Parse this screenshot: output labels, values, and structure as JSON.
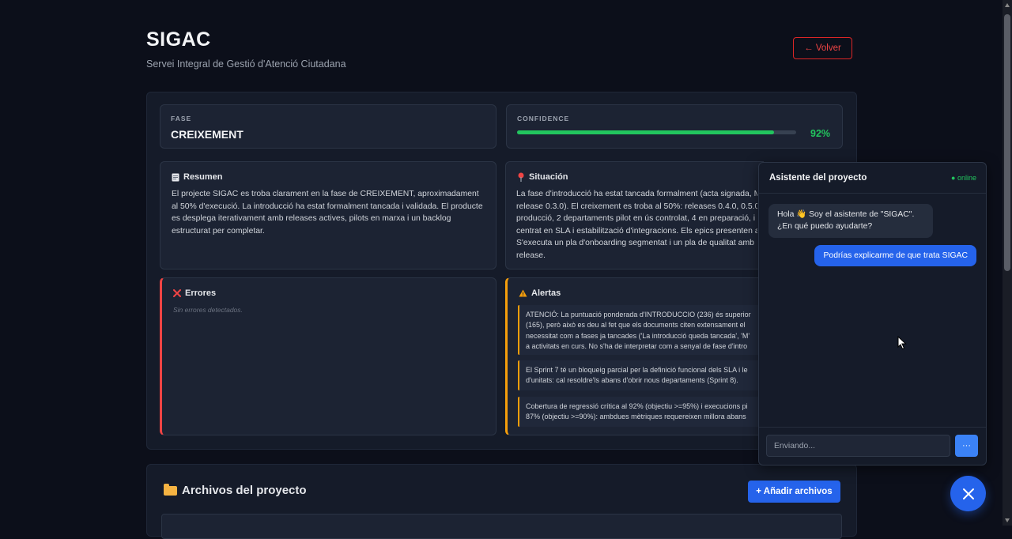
{
  "header": {
    "title": "SIGAC",
    "subtitle": "Servei Integral de Gestió d'Atenció Ciutadana",
    "back_label": "← Volver"
  },
  "phase": {
    "label": "FASE",
    "value": "CREIXEMENT"
  },
  "confidence": {
    "label": "CONFIDENCE",
    "percent_text": "92%",
    "level": 0.92,
    "color": "#22c55e"
  },
  "summary": {
    "icon": "document-icon",
    "title": "Resumen",
    "text": "El projecte SIGAC es troba clarament en la fase de CREIXEMENT, aproximadament al 50% d'execució. La introducció ha estat formalment tancada i validada. El producte es desplega iterativament amb releases actives, pilots en marxa i un backlog estructurat per completar."
  },
  "situation": {
    "icon": "pin-icon",
    "title": "Situación",
    "lines": [
      "La fase d'introducció ha estat tancada formalment (acta signada, M",
      "release 0.3.0). El creixement es troba al 50%: releases 0.4.0, 0.5.0 i 0.",
      "producció, 2 departaments pilot en ús controlat, 4 en preparació, i",
      "centrat en SLA i estabilització d'integracions. Els epics presenten av",
      "S'executa un pla d'onboarding segmentat i un pla de qualitat amb",
      "release."
    ]
  },
  "errors": {
    "icon": "x-icon",
    "title": "Errores",
    "empty_text": "Sin errores detectados."
  },
  "alerts": {
    "icon": "warning-icon",
    "title": "Alertas",
    "items": [
      {
        "lines": [
          "ATENCIÓ: La puntuació ponderada d'INTRODUCCIO (236) és superior",
          "(165), però això es deu al fet que els documents citen extensament el",
          "necessitat com a fases ja tancades ('La introducció queda tancada', 'M'",
          "a activitats en curs. No s'ha de interpretar com a senyal de fase d'intro"
        ]
      },
      {
        "lines": [
          "El Sprint 7 té un bloqueig parcial per la definició funcional dels SLA i le",
          "d'unitats: cal resoldre'ls abans d'obrir nous departaments (Sprint 8)."
        ]
      },
      {
        "lines": [
          "Cobertura de regressió crítica al 92% (objectiu >=95%) i execucions pi",
          "87% (objectiu >=90%): ambdues mètriques requereixen millora abans"
        ]
      }
    ]
  },
  "files": {
    "title": "Archivos del proyecto",
    "add_label": "+ Añadir archivos",
    "icon": "folder-icon"
  },
  "chat": {
    "title": "Asistente del proyecto",
    "status": "● online",
    "bot_message": "Hola 👋 Soy el asistente de \"SIGAC\". ¿En qué puedo ayudarte?",
    "user_message": "Podrías explicarme de que trata SIGAC",
    "input_placeholder": "Enviando...",
    "send_label": "···"
  }
}
